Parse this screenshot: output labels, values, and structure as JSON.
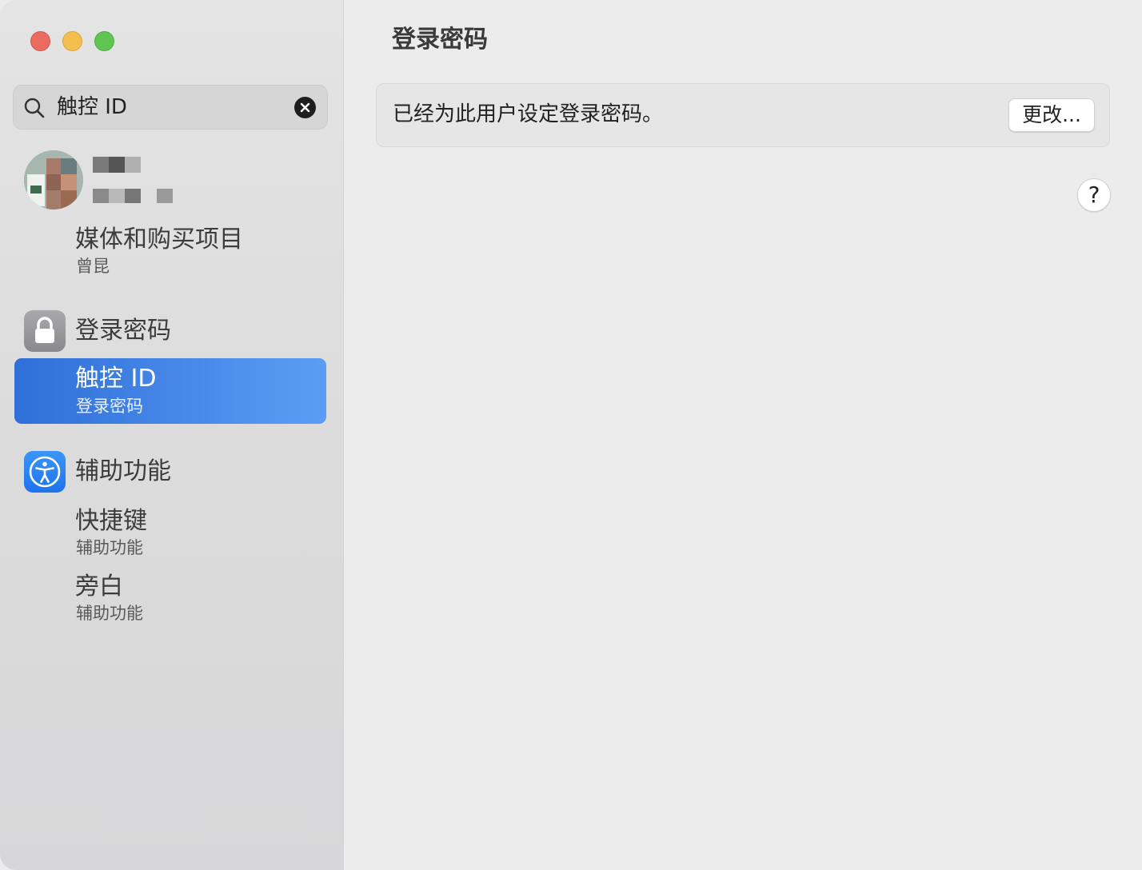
{
  "window": {
    "colors": {
      "close": "#ec6a5e",
      "minimize": "#f4bf4f",
      "zoom": "#61c554",
      "selection": "#2f6fd8"
    }
  },
  "sidebar": {
    "search": {
      "value": "触控 ID"
    },
    "results": [
      {
        "title": "媒体和购买项目",
        "subtitle": "曾昆"
      },
      {
        "section": "登录密码",
        "icon": "lock-icon"
      },
      {
        "title": "触控 ID",
        "subtitle": "登录密码",
        "selected": true
      },
      {
        "section": "辅助功能",
        "icon": "accessibility-icon"
      },
      {
        "title": "快捷键",
        "subtitle": "辅助功能"
      },
      {
        "title": "旁白",
        "subtitle": "辅助功能"
      }
    ]
  },
  "main": {
    "title": "登录密码",
    "password_status": "已经为此用户设定登录密码。",
    "change_button": "更改...",
    "help_button": "?"
  }
}
